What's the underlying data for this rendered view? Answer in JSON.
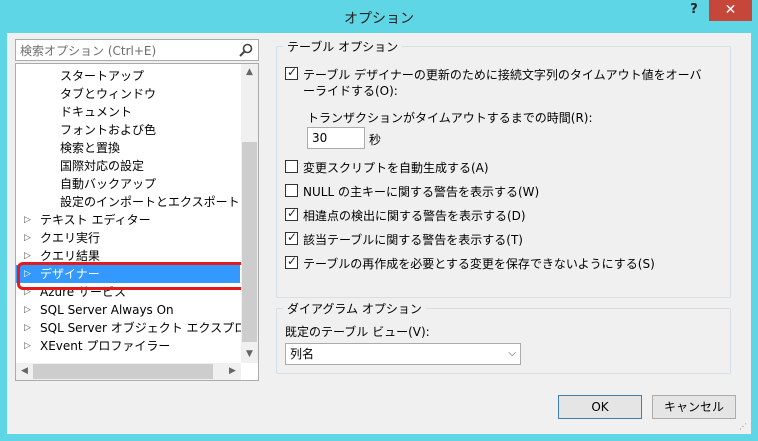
{
  "window": {
    "title": "オプション"
  },
  "titlebar": {
    "help_symbol": "?",
    "close_symbol": "✕"
  },
  "search": {
    "placeholder": "検索オプション (Ctrl+E)"
  },
  "tree": {
    "children": [
      "スタートアップ",
      "タブとウィンドウ",
      "ドキュメント",
      "フォントおよび色",
      "検索と置換",
      "国際対応の設定",
      "自動バックアップ",
      "設定のインポートとエクスポート"
    ],
    "items": [
      "テキスト エディター",
      "クエリ実行",
      "クエリ結果",
      "デザイナー",
      "Azure サービス",
      "SQL Server Always On",
      "SQL Server オブジェクト エクスプローラー",
      "XEvent プロファイラー"
    ],
    "selected": "デザイナー"
  },
  "table_options": {
    "title": "テーブル オプション",
    "timeout_label_line1": "テーブル デザイナーの更新のために接続文字列のタイムアウト値をオーバ",
    "timeout_label_line2": "ーライドする(O):",
    "timeout_checked": true,
    "transaction_label": "トランザクションがタイムアウトするまでの時間(R):",
    "transaction_value": "30",
    "transaction_unit": "秒",
    "checks": [
      {
        "label": "変更スクリプトを自動生成する(A)",
        "checked": false
      },
      {
        "label": "NULL の主キーに関する警告を表示する(W)",
        "checked": false
      },
      {
        "label": "相違点の検出に関する警告を表示する(D)",
        "checked": true
      },
      {
        "label": "該当テーブルに関する警告を表示する(T)",
        "checked": true
      },
      {
        "label": "テーブルの再作成を必要とする変更を保存できないようにする(S)",
        "checked": true
      }
    ]
  },
  "diagram_options": {
    "title": "ダイアグラム オプション",
    "default_view_label": "既定のテーブル ビュー(V):",
    "default_view_value": "列名"
  },
  "buttons": {
    "ok": "OK",
    "cancel": "キャンセル"
  }
}
